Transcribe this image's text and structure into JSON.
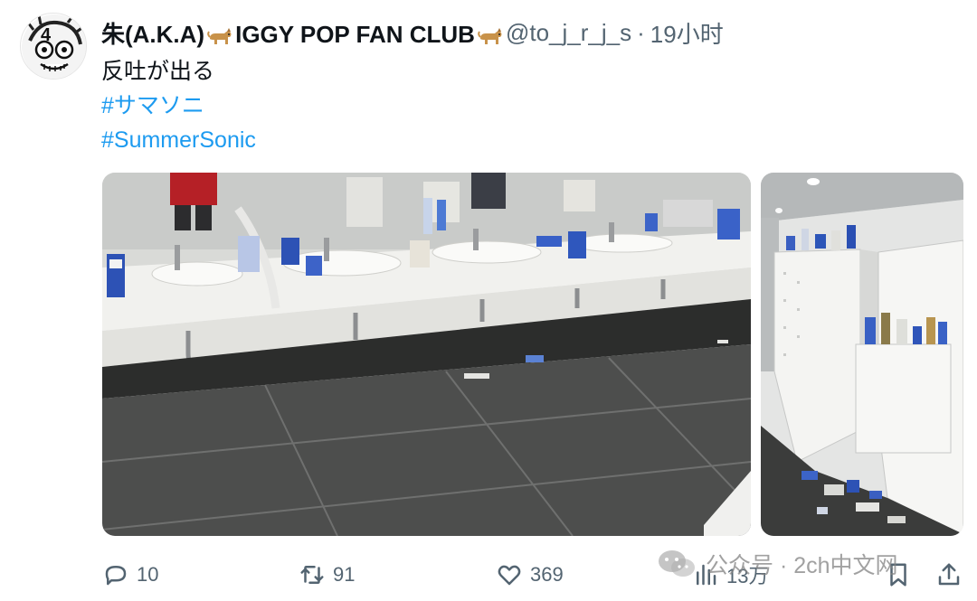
{
  "tweet": {
    "display_name_pre": "朱(A.K.A)",
    "display_name_post": "IGGY POP FAN CLUB",
    "handle": "@to_j_r_j_s",
    "separator": "·",
    "time": "19小时",
    "text_line": "反吐が出る",
    "hashtags": [
      "#サマソニ",
      "#SummerSonic"
    ]
  },
  "actions": {
    "replies": "10",
    "retweets": "91",
    "likes": "369",
    "views": "13万"
  },
  "watermark": {
    "text": "公众号 · 2ch中文网"
  },
  "icons": {
    "reply": "reply-icon",
    "retweet": "retweet-icon",
    "like": "heart-icon",
    "views": "views-icon",
    "bookmark": "bookmark-icon",
    "share": "share-icon",
    "emoji": "dog-emoji-icon",
    "watermark": "wechat-icon"
  },
  "colors": {
    "hashtag": "#1d9bf0",
    "secondary_text": "#536471",
    "primary_text": "#0f1419"
  }
}
